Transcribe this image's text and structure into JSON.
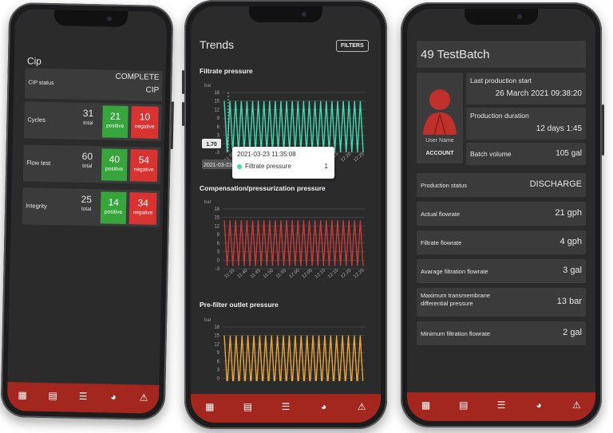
{
  "colors": {
    "accent_red": "#a3271f",
    "positive": "#37a53c",
    "negative": "#d93331",
    "filtrate": "#3ddbb0",
    "compensation": "#c83a3a",
    "prefilter": "#e8a33a"
  },
  "nav_icons": [
    "dashboard-icon",
    "chart-icon",
    "list-icon",
    "pie-icon",
    "warning-icon"
  ],
  "left": {
    "title": "Cip",
    "status": {
      "label": "CIP status",
      "value_line1": "COMPLETE",
      "value_line2": "CIP"
    },
    "rows": [
      {
        "label": "Cycles",
        "total": "31",
        "total_label": "total",
        "positive": "21",
        "positive_label": "positive",
        "negative": "10",
        "negative_label": "negative"
      },
      {
        "label": "Flow test",
        "total": "60",
        "total_label": "total",
        "positive": "40",
        "positive_label": "positive",
        "negative": "54",
        "negative_label": "negative"
      },
      {
        "label": "Integrity",
        "total": "25",
        "total_label": "total",
        "positive": "14",
        "positive_label": "positive",
        "negative": "34",
        "negative_label": "negative"
      }
    ]
  },
  "middle": {
    "title": "Trends",
    "filters_label": "FILTERS",
    "tooltip": {
      "date": "2021-03-23 11:35:08",
      "series": "Filtrate pressure",
      "value": "1"
    },
    "cursor": {
      "y_value": "1.70",
      "x_value": "2021-03-23"
    }
  },
  "chart_data": [
    {
      "type": "line",
      "title": "Filtrate pressure",
      "ylabel": "bar",
      "ylim": [
        -3,
        18
      ],
      "yticks": [
        "18",
        "15",
        "12",
        "9",
        "6",
        "3",
        "0",
        "-3"
      ],
      "xticks": [
        "11:35",
        "11:40",
        "11:45",
        "11:50",
        "11:55",
        "12:00",
        "12:05",
        "12:10",
        "12:15",
        "12:20",
        "12:25"
      ],
      "series": [
        {
          "values": [
            15,
            -3,
            15,
            -3,
            15,
            -3,
            15,
            -3,
            15,
            -3,
            15,
            -3,
            15,
            -3,
            15,
            -3,
            15,
            -3,
            15,
            -3,
            15,
            -3,
            15,
            -3,
            15,
            -3,
            15,
            -3,
            15,
            -3,
            15,
            -3,
            15,
            -3,
            15,
            -3,
            15,
            -3,
            15,
            -3,
            15,
            -3,
            15,
            -3,
            15,
            -3,
            15,
            -3,
            15,
            -3
          ]
        }
      ]
    },
    {
      "type": "line",
      "title": "Compensation/pressurization pressure",
      "ylabel": "bar",
      "ylim": [
        -3,
        18
      ],
      "yticks": [
        "18",
        "15",
        "12",
        "9",
        "6",
        "3",
        "0",
        "-3"
      ],
      "xticks": [
        "11:35",
        "11:40",
        "11:45",
        "11:50",
        "11:55",
        "12:00",
        "12:05",
        "12:10",
        "12:15",
        "12:20",
        "12:25"
      ],
      "series": [
        {
          "values": [
            14,
            -2,
            14,
            -2,
            14,
            -2,
            14,
            -2,
            14,
            -2,
            14,
            -2,
            14,
            -2,
            14,
            -2,
            14,
            -2,
            14,
            -2,
            14,
            -2,
            14,
            -2,
            14,
            -2,
            14,
            -2,
            14,
            -2,
            14,
            -2,
            14,
            -2,
            14,
            -2,
            14,
            -2,
            14,
            -2,
            14,
            -2,
            14,
            -2,
            14,
            -2,
            14,
            -2,
            14,
            -2
          ]
        }
      ]
    },
    {
      "type": "line",
      "title": "Pre-filter outlet pressure",
      "ylabel": "bar",
      "ylim": [
        -3,
        18
      ],
      "yticks": [
        "18",
        "15",
        "12",
        "9",
        "6",
        "3",
        "0",
        "-3"
      ],
      "xticks": [],
      "series": [
        {
          "values": [
            15,
            -3,
            15,
            -3,
            15,
            -3,
            15,
            -3,
            15,
            -3,
            15,
            -3,
            15,
            -3,
            15,
            -3,
            15,
            -3,
            15,
            -3,
            15,
            -3,
            15,
            -3,
            15,
            -3,
            15,
            -3,
            15,
            -3,
            15,
            -3,
            15,
            -3,
            15,
            -3,
            15,
            -3,
            15,
            -3,
            15,
            -3,
            15,
            -3,
            15,
            -3,
            15,
            -3
          ]
        }
      ]
    }
  ],
  "right": {
    "title": "49 TestBatch",
    "user_name": "User Name",
    "account_label": "ACCOUNT",
    "last_start_label": "Last production start",
    "last_start_value": "26 March 2021 09:38:20",
    "duration_label": "Production duration",
    "duration_value": "12 days 1:45",
    "volume_label": "Batch volume",
    "volume_value": "105 gal",
    "status_label": "Production status",
    "status_value": "DISCHARGE",
    "metrics": [
      {
        "label": "Actual flowrate",
        "value": "21 gph"
      },
      {
        "label": "Filtrate flowrate",
        "value": "4 gph"
      },
      {
        "label": "Avarage filtration flowrate",
        "value": "3 gal"
      },
      {
        "label": "Maximum transmembrane differential pressure",
        "value": "13 bar"
      },
      {
        "label": "Minimum filtration flowrate",
        "value": "2 gal"
      }
    ]
  }
}
